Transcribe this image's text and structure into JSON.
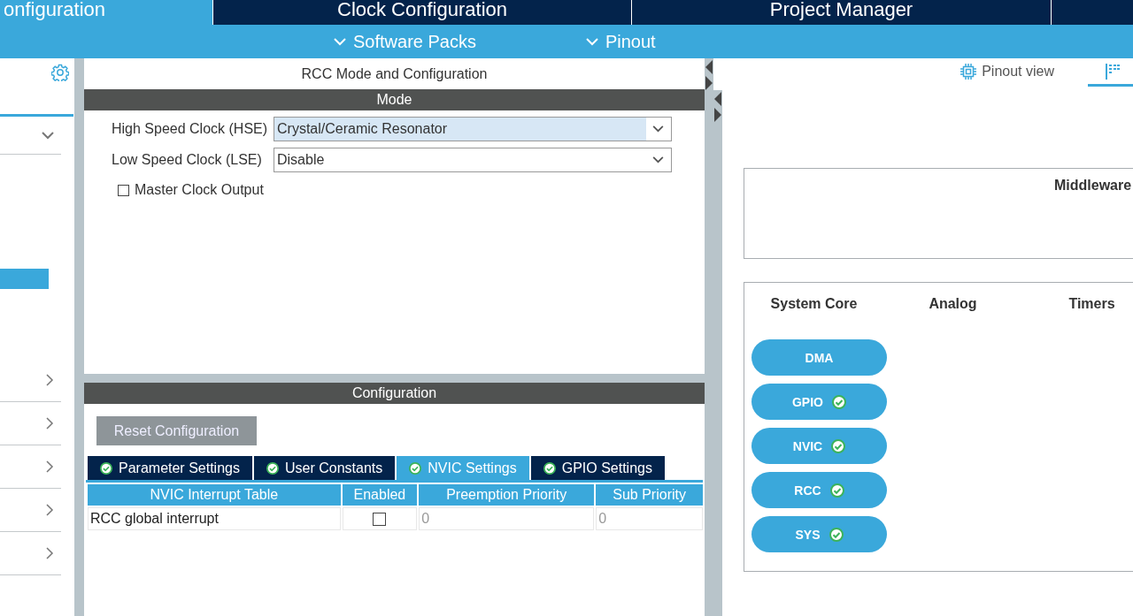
{
  "top_tabs": [
    {
      "label": "onfiguration",
      "selected": true
    },
    {
      "label": "Clock Configuration",
      "selected": false
    },
    {
      "label": "Project Manager",
      "selected": false
    },
    {
      "selected": false
    }
  ],
  "sub_menu": [
    {
      "label": "Software Packs"
    },
    {
      "label": "Pinout"
    }
  ],
  "sidebar": {
    "categories": [
      {
        "expanded": true,
        "children": [
          {
            "selected": true
          }
        ]
      },
      {
        "expanded": false
      },
      {
        "expanded": false
      },
      {
        "expanded": false
      },
      {
        "expanded": false
      },
      {
        "expanded": false
      }
    ]
  },
  "mode_panel": {
    "title": "RCC Mode and Configuration",
    "header": "Mode",
    "fields": [
      {
        "label": "High Speed Clock (HSE)",
        "value": "Crystal/Ceramic Resonator",
        "selected": true
      },
      {
        "label": "Low Speed Clock (LSE)",
        "value": "Disable",
        "selected": false
      }
    ],
    "checkboxes": [
      {
        "label": "Master Clock Output",
        "checked": false
      }
    ]
  },
  "configuration": {
    "header": "Configuration",
    "reset_button": "Reset Configuration",
    "tabs": [
      {
        "label": "Parameter Settings",
        "selected": false,
        "valid": true
      },
      {
        "label": "User Constants",
        "selected": false,
        "valid": true
      },
      {
        "label": "NVIC Settings",
        "selected": true,
        "valid": true
      },
      {
        "label": "GPIO Settings",
        "selected": false,
        "valid": true
      }
    ],
    "table": {
      "columns": [
        "NVIC Interrupt Table",
        "Enabled",
        "Preemption Priority",
        "Sub Priority"
      ],
      "rows": [
        {
          "name": "RCC global interrupt",
          "enabled": false,
          "preemption_priority": "0",
          "sub_priority": "0"
        }
      ]
    }
  },
  "right_panel": {
    "view_tabs": [
      {
        "label": "Pinout view",
        "kind": "chip",
        "selected": false
      },
      {
        "kind": "grid",
        "selected": true
      }
    ],
    "middleware": {
      "title": "Middleware"
    },
    "categories": {
      "columns": [
        "System Core",
        "Analog",
        "Timers"
      ],
      "items": [
        {
          "label": "DMA",
          "configured": false
        },
        {
          "label": "GPIO",
          "configured": true
        },
        {
          "label": "NVIC",
          "configured": true
        },
        {
          "label": "RCC",
          "configured": true
        },
        {
          "label": "SYS",
          "configured": true
        }
      ]
    }
  }
}
